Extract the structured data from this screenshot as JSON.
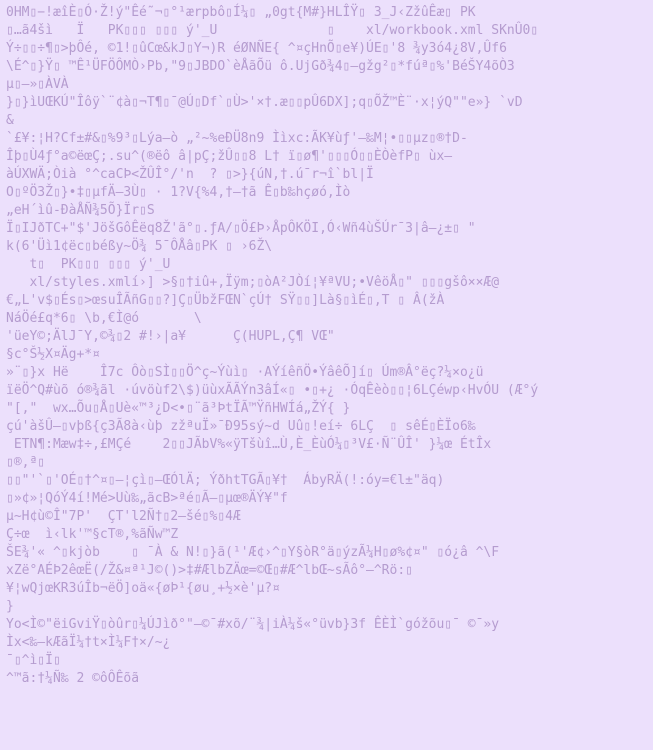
{
  "colors": {
    "background": "#ece0fc",
    "text": "#b59ccf"
  },
  "lines": [
    "0HM▯−!æîÈ▯Ó·Ž!ý\"Êé˜¬▯°¹ærpbô▯Í¼▯ „0gt{M#}HLÎŸ▯ 3_J‹ZžûÊæ▯ PK",
    "▯…ã4šì   Ï   PK▯▯▯ ▯▯▯ ý'_U              ▯    xl/workbook.xml SKnÛ0▯",
    "Ý÷▯▯÷¶▯>þÔé, ©1!▯ûCœ&kJ▯Y¬)R éØNÑE{ ^¤çHnÕ▯e¥)ÚE▯'8 ¾y3ó4¿8V,Ûf6",
    "\\É^▯}Ÿ▯ ™Ê¹ÜFÖÔMÒ›Pb,\"9▯JBDO`èÅãÕü ô.UjGð¾4▯–gžg²▯*fúª▯%'BéŠY4õÒ3",
    "µ▯–»▯ÀVÀ",
    "}▯}ìUŒKÚ\"Îôÿ`¨¢à▯¬T¶▯¯@Ú▯Df`▯Ù>'×†.æ▯▯pÛ6DX];q▯ÕŽ™È¨·x¦ýQ\"\"e»} `vD",
    "&",
    "`£¥:¦H?Cf±#&▯%9³▯Lýa–ò „²~%eÐÜ8n9 Ììxc:ÃK¥ùƒ'–‰M¦•▯▯µz▯®†D-",
    "Îþ▯Ù4ƒ°a©ëœÇ;.su^(®ëô â|pÇ;žÛ▯▯8 L† ï▯ø¶'▯▯▯Ó▯▯ÈÒèfP▯ ùx–",
    "àÚXWÄ;Òià °^caCÞ<ŽÛÎ°/'n  ? ▯>}{úN,†.ú¯r¬î`bl|Ï",
    "O▯ºÖ3Ž▯}•‡▯µfÄ–3Ù▯ · 1?V{%4,†–†ã Ê▯b‰hçøó,Ìò",
    "„eH´ìû-ÐàÅÑ¾5Õ}Ïr▯S",
    "Ï▯IJðTC+\"$'JöšGôÊëq8Ž'ã°▯.ƒA/▯Ö£Þ›ÅpÔKÖI,Ó‹Wñ4ùŠÚr¯3|â–¿±▯ \"",
    "k(6'Üì1¢ëc▯béßy~Ö¾ 5¯ÔÅâ▯PK ▯ ›6Ž\\",
    "   t▯  PK▯▯▯ ▯▯▯ ý'_U",
    "   xl/styles.xmlí›] >§▯†iû+,Ïÿm;▯òA²JÒí¦¥ªVU;•VêöÅ▯\" ▯▯▯gšô××Æ@",
    "€„L'v$▯És▯>œsuÎÃñG▯▯?]Ç▯ÜbžFŒN`çÚ† SŸ▯▯]Là§▯ìÉ▯,T ▯ Â(žÀ",
    "NáÖé£q*6▯ \\b,€Ì@ó       \\",
    "'üeY©;ÄlJ¯Y,©¾▯2 #!›|a¥      Ç(HUPL,Ç¶ VŒ\"",
    "§c°Š½X¤Äg+*¤",
    "»¨▯}x Hë    Î7c Ôò▯SÌ▯▯Ö^ç~Ýùì▯ ·AÝíêñÖ•ÝâêÕ]í▯ Úm®Â°ëç?¼×o¿ü",
    "ïëÖ^Q#ùõ ó®¾ãl ·úvöùf2\\$)üùxÃÃÝn3âÍ«▯ •▯+¿ ·ÓqÊèò▯▯¦6LÇéwp‹HvÓU (Æ°ý",
    "\"[,\"  wx…Õu▯Å▯Uè«™³¿D<•▯¨ã³ÞtÏÃ™ŸñHWÍá„ŽÝ{ }",
    "çú'àšÛ–▯vþß{ç3Ã8à‹ùþ zžªuÏ»¯Ð95sý~d Uû▯!eí÷ 6LÇ  ▯ sêÉ▯ÈÏo6‰",
    " ETN¶:Mæw‡÷,£MÇé    2▯▯JÃbV%«ÿTšùî…Ù,È_ÈùÓ¼▯³V£·Ñ¨ÛÎ' }¼œ ÉtÎx",
    "▯®,ª▯",
    "▯▯\"'`▯'OÉ▯†^¤▯–¦çì▯–ŒÓlÄ; ÝðhtTGÃ▯¥†  ÁbyRÄ(!:óy=€l±\"äq)",
    "▯»¢»¦QóÝ4í!Mé>Uù‰„ãcB>ªé▯Ã–▯µœ®ÄÝ¥\"f",
    "µ~H¢ù©Î\"7P'  ÇT'l2Ñ†▯2–šé▯%▯4Æ",
    "Ç÷œ  ì‹lk'™§cT®,%ãÑw™Z",
    "ŠE¾'« ^▯kjòb    ▯ ¯À & N!▯}ã(¹'Æ¢›^▯Y§òR°ä▯ýzÃ¼H▯ø%¢¤\" ▯ó¿â ^\\F",
    "xZë°AÉÞ2êœË(/Ž&¤ª¹J©()>‡#ÆlbZÄœ=©Œ▯#Æ^lbŒ~sÃô°–^Rö:▯",
    "¥¦wQjœKR3úÎb¬ëÖ]oä«{øÞ¹{øu¸+½×è'µ?¤",
    "}",
    "Yo<Ì©\"ëiGviŸ▯òûr▯¼ÚJìð°\"–©¯#xõ/¨¾|iÀ¼š«°üvb}3f ÊÈÌ`góžõu▯¯ ©¯»y",
    "Ìx<‰–kÆãÏ¼†t×Ì¼F†×/~¿",
    "¯▯^ì▯Ï▯",
    "^™ã:†¼Ñ‰ 2 ©ôÔÊõã"
  ]
}
